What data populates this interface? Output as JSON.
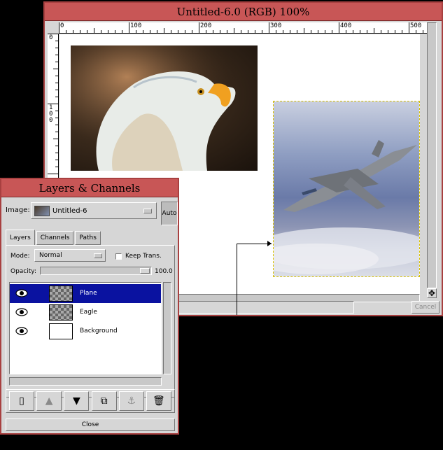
{
  "image_window": {
    "title": "Untitled-6.0 (RGB) 100%",
    "ruler_top_labels": [
      "0",
      "100",
      "200",
      "300",
      "400",
      "500"
    ],
    "ruler_left_labels": [
      "0",
      "1 0 0"
    ],
    "status_text": "",
    "cancel_label": "Cancel",
    "layers_shown": [
      "Eagle",
      "Plane"
    ]
  },
  "layers_window": {
    "title": "Layers & Channels",
    "image_label": "Image:",
    "image_value": "Untitled-6",
    "auto_label": "Auto",
    "tabs": [
      {
        "label": "Layers",
        "active": true
      },
      {
        "label": "Channels",
        "active": false
      },
      {
        "label": "Paths",
        "active": false
      }
    ],
    "mode_label": "Mode:",
    "mode_value": "Normal",
    "keep_trans_label": "Keep Trans.",
    "keep_trans_checked": false,
    "opacity_label": "Opacity:",
    "opacity_value": "100.0",
    "opacity_fraction": 1.0,
    "layers": [
      {
        "name": "Plane",
        "visible": true,
        "selected": true,
        "thumb": "plane"
      },
      {
        "name": "Eagle",
        "visible": true,
        "selected": false,
        "thumb": "eagle"
      },
      {
        "name": "Background",
        "visible": true,
        "selected": false,
        "thumb": "white"
      }
    ],
    "buttons": [
      {
        "name": "new-layer",
        "icon": "page-icon"
      },
      {
        "name": "raise-layer",
        "icon": "arrow-up-icon"
      },
      {
        "name": "lower-layer",
        "icon": "arrow-down-icon"
      },
      {
        "name": "duplicate-layer",
        "icon": "duplicate-icon"
      },
      {
        "name": "anchor-layer",
        "icon": "anchor-icon"
      },
      {
        "name": "delete-layer",
        "icon": "trash-icon"
      }
    ],
    "close_label": "Close"
  },
  "colors": {
    "title_bar": "#c85656",
    "window_bg": "#d6d6d6",
    "selection": "#0a12a0"
  }
}
